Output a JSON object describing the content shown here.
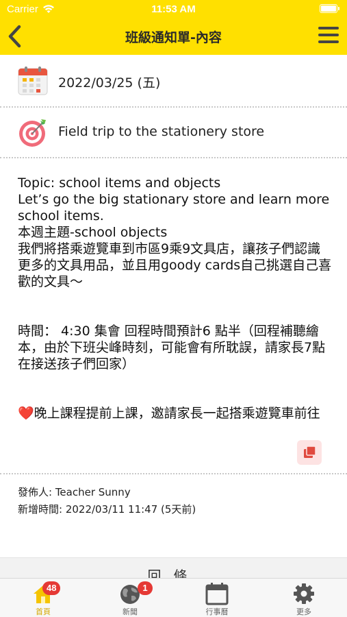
{
  "status_bar": {
    "carrier": "Carrier",
    "time": "11:53 AM"
  },
  "nav": {
    "title": "班級通知單-內容",
    "back_icon": "chevron-left-icon",
    "menu_icon": "hamburger-menu-icon"
  },
  "notice": {
    "date": "2022/03/25 (五)",
    "date_icon": "calendar-icon",
    "title": "Field trip to the stationery store",
    "title_icon": "target-icon",
    "body": "Topic: school items and objects\nLet’s go the big stationary store and learn more school items.\n本週主題-school objects\n我們將搭乘遊覽車到市區9乘9文具店，讓孩子們認識更多的文具用品，並且用goody cards自己挑選自己喜歡的文具～\n\n\n時間： 4:30 集會 回程時間預計6 點半（回程補聽繪本，由於下班尖峰時刻，可能會有所耽誤，請家長7點在接送孩子們回家）\n\n\n❤️晚上課程提前上課，邀請家長一起搭乘遊覽車前往",
    "copy_icon": "copy-icon",
    "publisher": "發佈人: Teacher Sunny",
    "created": "新增時間: 2022/03/11 11:47 (5天前)"
  },
  "reply": {
    "label": "回條"
  },
  "tabbar": {
    "tabs": [
      {
        "label": "首頁",
        "icon": "home-icon",
        "badge": "48",
        "active": true
      },
      {
        "label": "新聞",
        "icon": "globe-icon",
        "badge": "1",
        "active": false
      },
      {
        "label": "行事曆",
        "icon": "calendar-icon",
        "badge": "",
        "active": false
      },
      {
        "label": "更多",
        "icon": "gear-icon",
        "badge": "",
        "active": false
      }
    ]
  },
  "colors": {
    "header": "#FFE000",
    "badge": "#E53935",
    "active_tab": "#D4A800"
  }
}
